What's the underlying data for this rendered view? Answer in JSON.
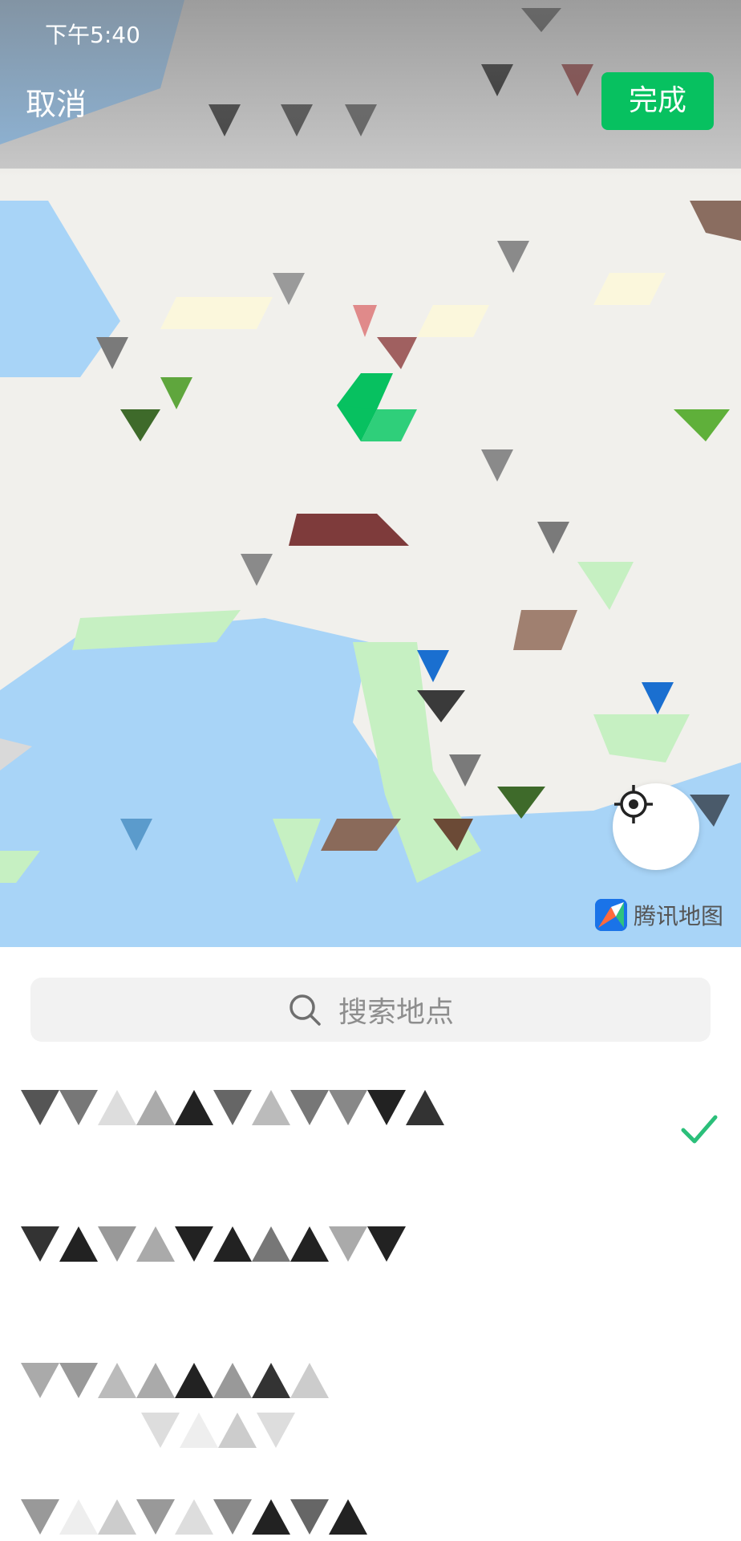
{
  "status_bar": {
    "time": "下午5:40"
  },
  "header": {
    "cancel_label": "取消",
    "done_label": "完成"
  },
  "map": {
    "provider_label": "腾讯地图",
    "locate_icon": "crosshair-icon"
  },
  "search": {
    "placeholder": "搜索地点"
  },
  "results": [
    {
      "selected": true
    },
    {
      "selected": false
    },
    {
      "selected": false
    },
    {
      "selected": false
    }
  ],
  "colors": {
    "accent": "#07c160",
    "water": "#a8d4f7",
    "park": "#c6f0c2",
    "land": "#f1f0ec",
    "check": "#2bbf7a"
  }
}
